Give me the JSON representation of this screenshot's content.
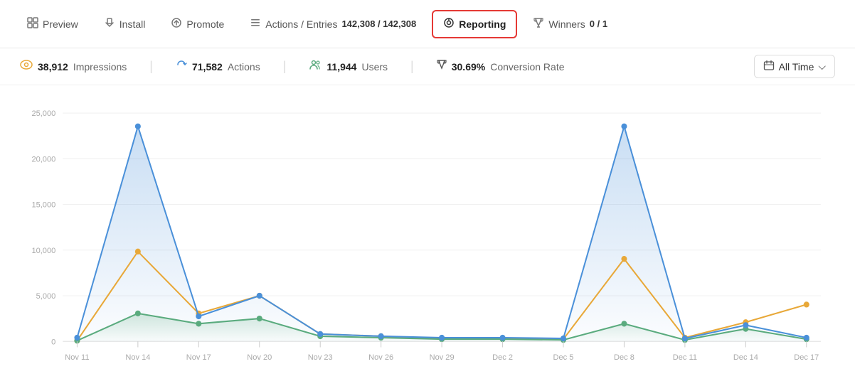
{
  "nav": {
    "items": [
      {
        "id": "preview",
        "label": "Preview",
        "icon": "⊞",
        "active": false,
        "badge": null
      },
      {
        "id": "install",
        "label": "Install",
        "icon": "↙",
        "active": false,
        "badge": null
      },
      {
        "id": "promote",
        "label": "Promote",
        "icon": "↗",
        "active": false,
        "badge": null
      },
      {
        "id": "actions",
        "label": "Actions / Entries",
        "icon": "≡",
        "active": false,
        "badge": "142,308 / 142,308"
      },
      {
        "id": "reporting",
        "label": "Reporting",
        "icon": "◎",
        "active": true,
        "badge": null
      },
      {
        "id": "winners",
        "label": "Winners",
        "icon": "🏆",
        "active": false,
        "badge": "0 / 1"
      }
    ]
  },
  "stats": {
    "impressions": {
      "value": "38,912",
      "label": "Impressions",
      "icon": "👁",
      "color": "#e8a838"
    },
    "actions": {
      "value": "71,582",
      "label": "Actions",
      "icon": "↺",
      "color": "#e8a838"
    },
    "users": {
      "value": "11,944",
      "label": "Users",
      "icon": "👥",
      "color": "#5aab7e"
    },
    "conversion": {
      "value": "30.69%",
      "label": "Conversion Rate",
      "icon": "🏆",
      "color": "#555"
    }
  },
  "timeFilter": {
    "label": "All Time",
    "icon": "📅"
  },
  "chart": {
    "yLabels": [
      "25,000",
      "20,000",
      "15,000",
      "10,000",
      "5,000",
      "0"
    ],
    "xLabels": [
      "Nov 11",
      "Nov 14",
      "Nov 17",
      "Nov 20",
      "Nov 23",
      "Nov 26",
      "Nov 29",
      "Dec 2",
      "Dec 5",
      "Dec 8",
      "Dec 11",
      "Dec 14",
      "Dec 17"
    ],
    "colors": {
      "blue": "#4a90d9",
      "orange": "#e8a838",
      "green": "#5aab7e"
    }
  }
}
